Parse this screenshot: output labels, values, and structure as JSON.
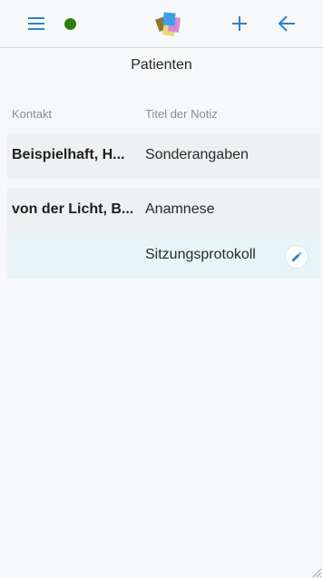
{
  "header": {
    "menu_icon": "hamburger-menu-icon",
    "status_color": "#2e7d12",
    "add_icon": "plus-icon",
    "back_icon": "arrow-left-icon",
    "accent_color": "#2f80c8"
  },
  "page": {
    "title": "Patienten"
  },
  "table": {
    "columns": [
      "Kontakt",
      "Titel der Notiz"
    ],
    "rows": [
      {
        "contact": "Beispielhaft, H...",
        "title": "Sonderangaben",
        "editable": false
      },
      {
        "contact": "von der Licht, B...",
        "title": "Anamnese",
        "editable": false
      },
      {
        "contact": "",
        "title": "Sitzungsprotokoll",
        "editable": true
      }
    ]
  }
}
